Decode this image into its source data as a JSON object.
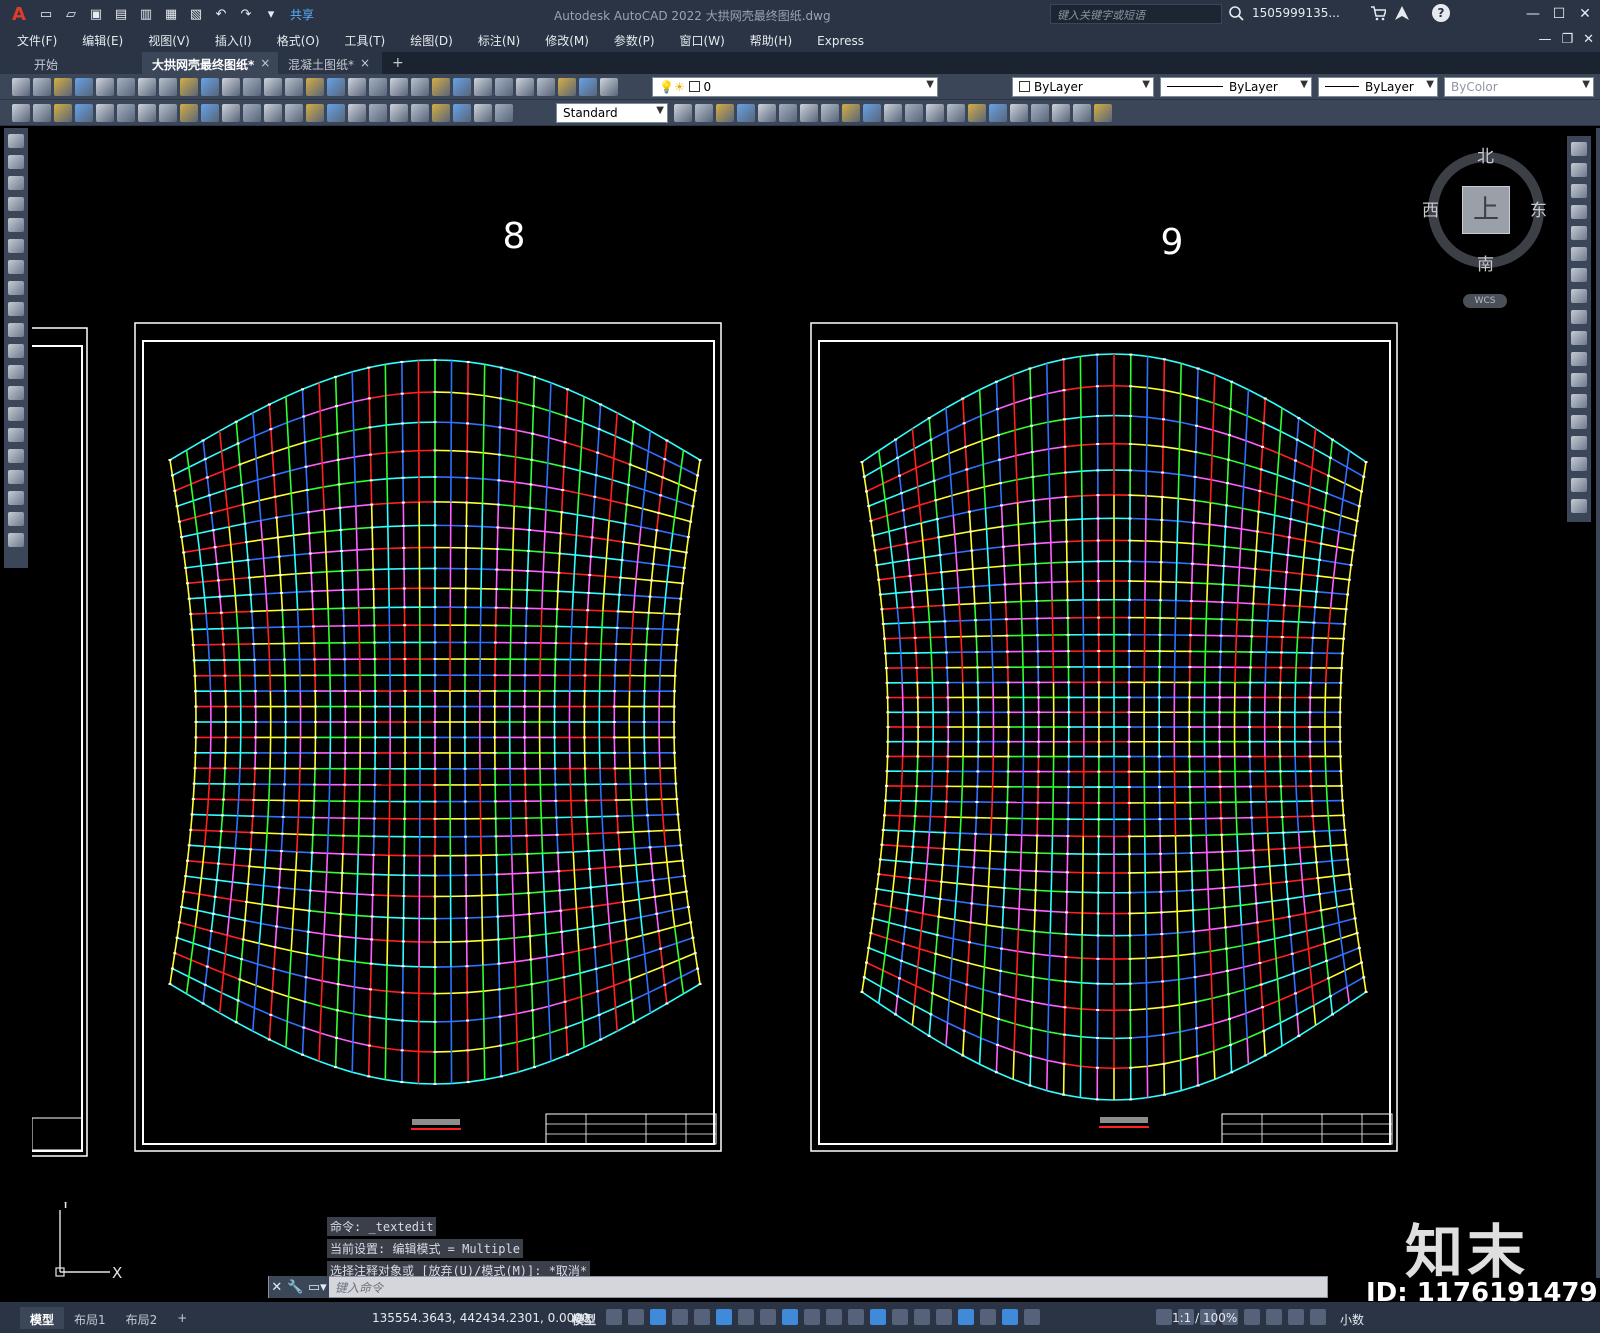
{
  "app": {
    "logo_letter": "A",
    "title": "Autodesk AutoCAD 2022    大拱网壳最终图纸.dwg",
    "share_label": "共享",
    "search_placeholder": "键入关键字或短语",
    "user": "1505999135...",
    "help": "?"
  },
  "menu": [
    "文件(F)",
    "编辑(E)",
    "视图(V)",
    "插入(I)",
    "格式(O)",
    "工具(T)",
    "绘图(D)",
    "标注(N)",
    "修改(M)",
    "参数(P)",
    "窗口(W)",
    "帮助(H)",
    "Express"
  ],
  "tabs": {
    "start": "开始",
    "active": "大拱网壳最终图纸*",
    "other": "混凝土图纸*",
    "close": "×",
    "add": "+"
  },
  "toolbar": {
    "layer_value": "0",
    "color_value": "ByLayer",
    "linetype_value": "ByLayer",
    "lineweight_value": "ByLayer",
    "plotstyle_value": "ByColor",
    "textstyle_value": "Standard"
  },
  "viewcube": {
    "face": "上",
    "north": "北",
    "south": "南",
    "east": "东",
    "west": "西",
    "wcs": "WCS"
  },
  "drawing": {
    "sheet_left_label": "8",
    "sheet_right_label": "9",
    "ucs_y": "Y",
    "ucs_x": "X"
  },
  "command": {
    "history": [
      "命令: _textedit",
      "当前设置: 编辑模式 = Multiple",
      "选择注释对象或 [放弃(U)/模式(M)]: *取消*"
    ],
    "placeholder": "键入命令"
  },
  "status": {
    "layouts": [
      "模型",
      "布局1",
      "布局2"
    ],
    "add_layout": "+",
    "coords": "135554.3643, 442434.2301, 0.0000",
    "space": "模型",
    "scale": "1:1 / 100%",
    "units": "小数"
  },
  "watermark": {
    "logo": "知末",
    "id": "ID: 1176191479"
  },
  "colors": {
    "grid_red": "#ff2020",
    "grid_yellow": "#ffff30",
    "grid_green": "#30ff30",
    "grid_cyan": "#30ffff",
    "grid_blue": "#3070ff",
    "grid_magenta": "#ff60ff",
    "grid_white": "#ffffff"
  }
}
